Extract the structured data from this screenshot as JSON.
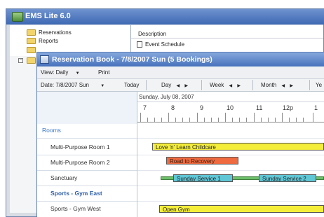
{
  "app": {
    "title": "EMS Lite 6.0"
  },
  "tree": {
    "items": [
      {
        "label": "Reservations"
      },
      {
        "label": "Reports"
      }
    ]
  },
  "details": {
    "column_header": "Description",
    "rows": [
      {
        "label": "Event Schedule"
      }
    ]
  },
  "reservation_book": {
    "title": "Reservation Book - 7/8/2007 Sun (5 Bookings)",
    "view_label": "View: Daily",
    "print_label": "Print",
    "date_label": "Date: 7/8/2007 Sun",
    "today_label": "Today",
    "nav": [
      {
        "label": "Day"
      },
      {
        "label": "Week"
      },
      {
        "label": "Month"
      },
      {
        "label": "Ye"
      }
    ],
    "date_header": "Sunday, July 08, 2007",
    "hours": [
      "7",
      "8",
      "9",
      "10",
      "11",
      "12p",
      "1"
    ],
    "rooms_header": "Rooms",
    "rooms": [
      {
        "label": "Multi-Purpose Room 1"
      },
      {
        "label": "Multi-Purpose Room 2"
      },
      {
        "label": "Sanctuary"
      },
      {
        "label": "Sports - Gym East"
      },
      {
        "label": "Sports - Gym West"
      }
    ],
    "bookings": [
      {
        "label": "Love 'n' Learn Childcare",
        "color": "#f4ee3a"
      },
      {
        "label": "Road to Recovery",
        "color": "#ef6a3e"
      },
      {
        "label": "Sunday Service 1",
        "color": "#5fc6d6"
      },
      {
        "label": "Sunday Service 2",
        "color": "#5fc6d6"
      },
      {
        "label": "Open Gym",
        "color": "#f4ee3a"
      }
    ]
  },
  "colors": {
    "title_bar": "#4671bb",
    "rooms_header": "#3a78c8",
    "gym_east_text": "#2f5fa8",
    "setup_bar": "#6dbd6a"
  }
}
